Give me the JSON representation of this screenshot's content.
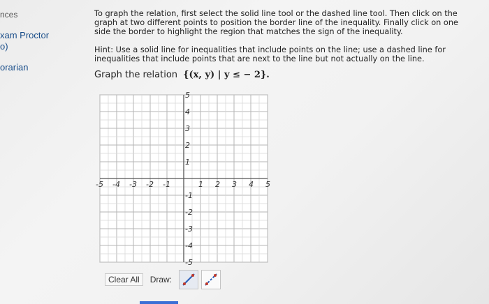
{
  "sidebar": {
    "items": [
      {
        "label": "nces",
        "kind": "plain"
      },
      {
        "label": "xam Proctor",
        "kind": "link"
      },
      {
        "label": "o)",
        "kind": "link"
      },
      {
        "label": "orarian",
        "kind": "link"
      }
    ]
  },
  "instructions": "To graph the relation, first select the solid line tool or the dashed line tool. Then click on the graph at two different points to position the border line of the inequality. Finally click on one side the border to highlight the region that matches the sign of the inequality.",
  "hint": "Hint: Use a solid line for inequalities that include points on the line; use a dashed line for inequalities that include points that are next to the line but not actually on the line.",
  "prompt": {
    "label": "Graph the relation",
    "math": "{(x, y) | y ≤ − 2}."
  },
  "graph": {
    "x_range": [
      -5,
      5
    ],
    "y_range": [
      -5,
      5
    ],
    "x_tick_labels": [
      "-5",
      "-4",
      "-3",
      "-2",
      "-1",
      "1",
      "2",
      "3",
      "4",
      "5"
    ],
    "y_tick_labels": [
      "5",
      "4",
      "3",
      "2",
      "1",
      "-1",
      "-2",
      "-3",
      "-4",
      "-5"
    ]
  },
  "toolbar": {
    "clear_label": "Clear All",
    "draw_label": "Draw:",
    "tools": [
      {
        "name": "solid-line-tool",
        "style": "solid"
      },
      {
        "name": "dashed-line-tool",
        "style": "dashed"
      }
    ]
  },
  "colors": {
    "link": "#1a4e8a",
    "tool_red": "#c0392b",
    "tool_blue": "#2b5fb8",
    "grid": "#c8c8c8"
  }
}
